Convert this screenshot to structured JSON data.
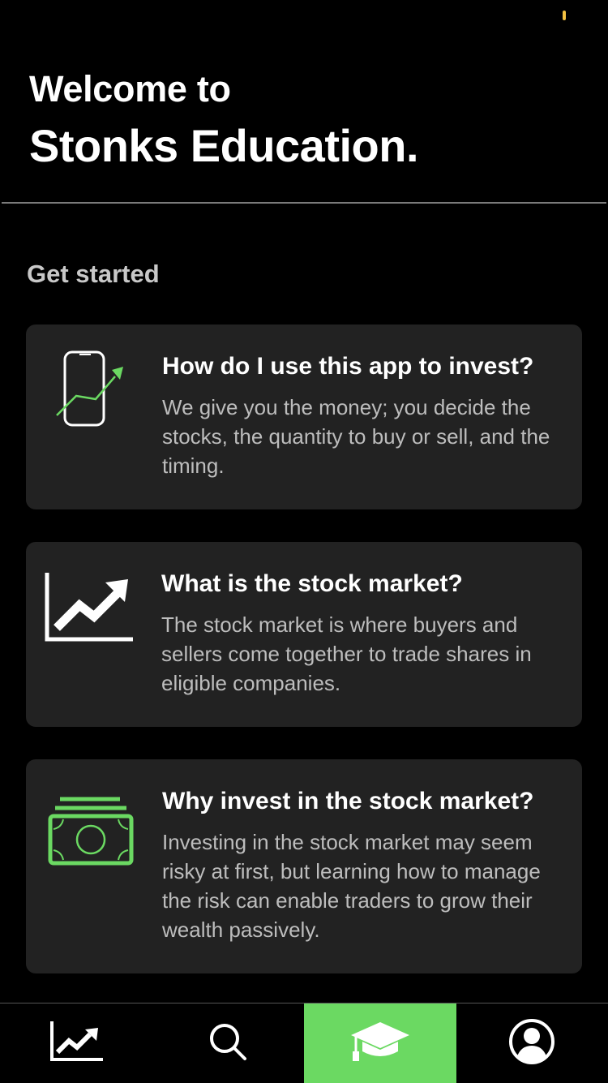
{
  "header": {
    "welcome": "Welcome to",
    "app_name": "Stonks Education."
  },
  "section": {
    "title": "Get started"
  },
  "cards": [
    {
      "title": "How do I use this app to invest?",
      "description": "We give you the money; you decide the stocks, the quantity to buy or sell, and the timing.",
      "icon": "phone-trend-icon"
    },
    {
      "title": "What is the stock market?",
      "description": "The stock market is where buyers and sellers come together to trade shares in eligible companies.",
      "icon": "trending-chart-icon"
    },
    {
      "title": "Why invest in the stock market?",
      "description": "Investing in the stock market may seem risky at first, but learning how to manage the risk can enable traders to grow their wealth passively.",
      "icon": "money-stack-icon"
    }
  ],
  "tabbar": {
    "tabs": [
      {
        "icon": "chart-icon",
        "active": false
      },
      {
        "icon": "search-icon",
        "active": false
      },
      {
        "icon": "graduation-cap-icon",
        "active": true
      },
      {
        "icon": "profile-icon",
        "active": false
      }
    ],
    "accent_color": "#6bd962"
  },
  "colors": {
    "background": "#000000",
    "card": "#222222",
    "accent_green": "#6bd962",
    "status_indicator": "#f5c242"
  }
}
